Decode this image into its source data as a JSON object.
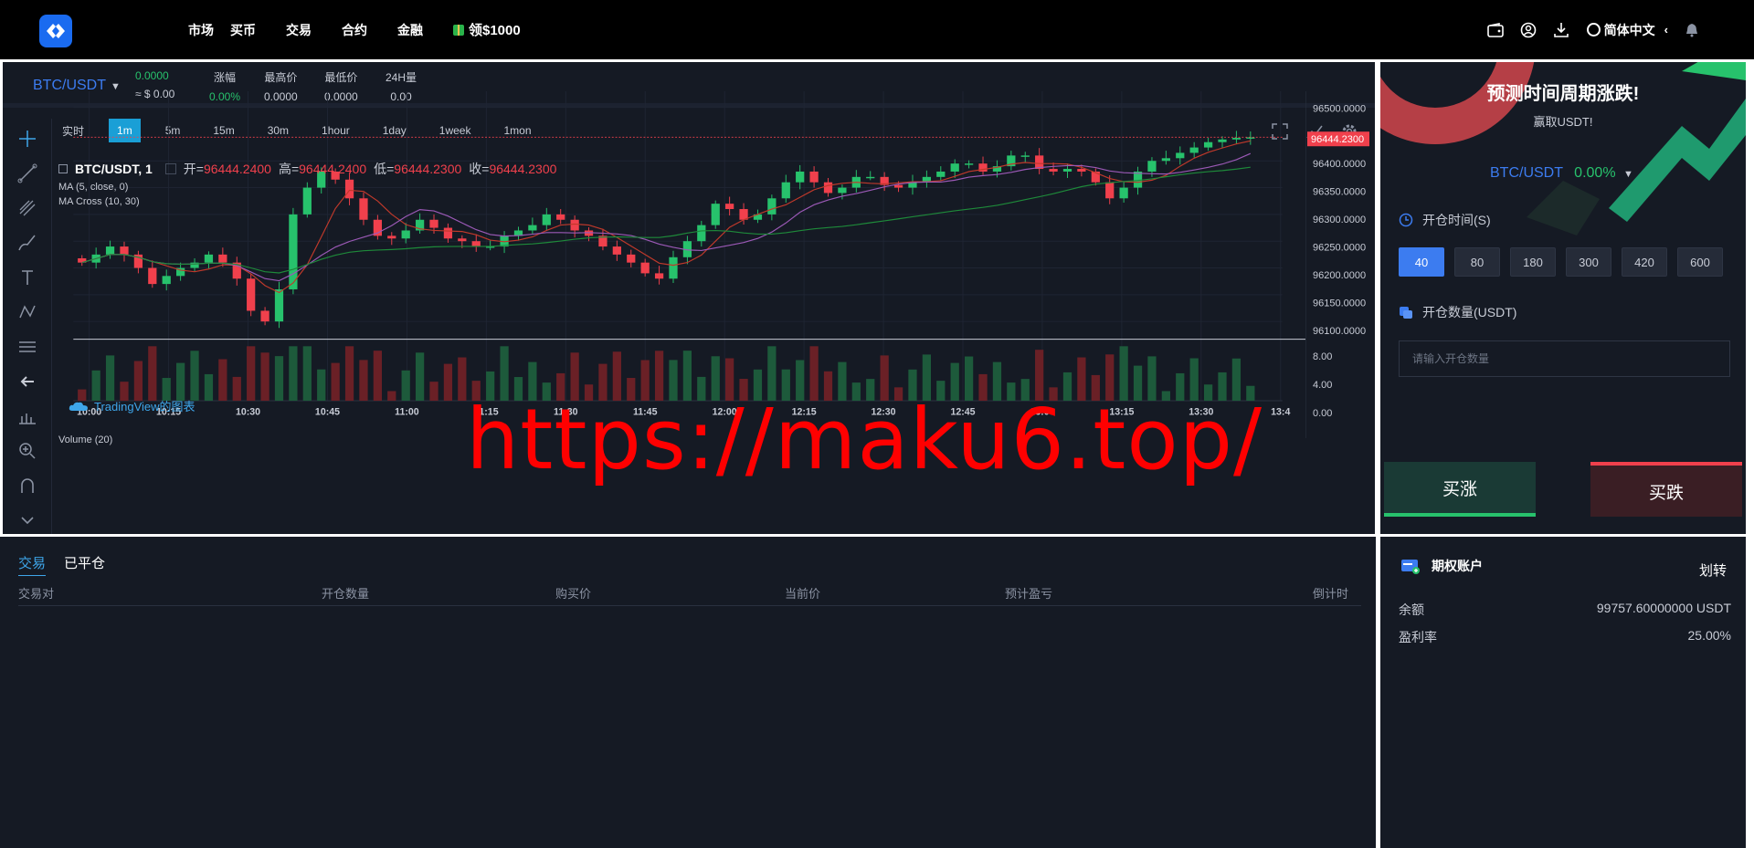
{
  "header": {
    "nav": [
      "市场",
      "买币",
      "交易",
      "合约",
      "金融"
    ],
    "promo": "领$1000",
    "language": "简体中文",
    "icons": [
      "wallet-icon",
      "user-icon",
      "download-icon",
      "globe-icon",
      "bell-icon"
    ]
  },
  "ticker": {
    "pair": "BTC/USDT",
    "price": "0.0000",
    "price_usd": "≈ $ 0.00",
    "stats": [
      {
        "label": "涨幅",
        "value": "0.00%"
      },
      {
        "label": "最高价",
        "value": "0.0000"
      },
      {
        "label": "最低价",
        "value": "0.0000"
      },
      {
        "label": "24H量",
        "value": "0.00"
      }
    ]
  },
  "chart_toolbar": {
    "timeframes": [
      "实时",
      "1m",
      "5m",
      "15m",
      "30m",
      "1hour",
      "1day",
      "1week",
      "1mon"
    ],
    "active": "1m"
  },
  "chart_data": {
    "type": "candlestick",
    "legend": {
      "symbol": "BTC/USDT, 1",
      "open_label": "开=",
      "open": "96444.2400",
      "high_label": "高=",
      "high": "96444.2400",
      "low_label": "低=",
      "low": "96444.2300",
      "close_label": "收=",
      "close": "96444.2300",
      "indicators": [
        "MA (5, close, 0)",
        "MA Cross (10, 30)"
      ],
      "volume_label": "Volume (20)"
    },
    "y_ticks": [
      "96500.0000",
      "96400.0000",
      "96350.0000",
      "96300.0000",
      "96250.0000",
      "96200.0000",
      "96150.0000",
      "96100.0000"
    ],
    "y_tick_values": [
      96500,
      96400,
      96350,
      96300,
      96250,
      96200,
      96150,
      96100
    ],
    "current_price": "96444.2300",
    "volume_ticks": [
      "8.00",
      "4.00",
      "0.00"
    ],
    "x_ticks": [
      "10:00",
      "10:15",
      "10:30",
      "10:45",
      "11:00",
      "11:15",
      "11:30",
      "11:45",
      "12:00",
      "12:15",
      "12:30",
      "12:45",
      "13:00",
      "13:15",
      "13:30",
      "13:4"
    ],
    "ylim": [
      96080,
      96530
    ],
    "closes": [
      96210,
      96225,
      96240,
      96225,
      96200,
      96170,
      96185,
      96200,
      96210,
      96225,
      96210,
      96180,
      96120,
      96100,
      96160,
      96300,
      96350,
      96380,
      96365,
      96330,
      96290,
      96260,
      96255,
      96270,
      96290,
      96275,
      96255,
      96250,
      96240,
      96240,
      96260,
      96270,
      96280,
      96300,
      96290,
      96270,
      96260,
      96240,
      96225,
      96210,
      96190,
      96180,
      96220,
      96250,
      96280,
      96320,
      96310,
      96290,
      96300,
      96330,
      96360,
      96380,
      96360,
      96340,
      96350,
      96370,
      96370,
      96355,
      96350,
      96360,
      96370,
      96380,
      96395,
      96395,
      96380,
      96390,
      96410,
      96410,
      96385,
      96380,
      96385,
      96380,
      96360,
      96330,
      96350,
      96380,
      96400,
      96405,
      96415,
      96425,
      96435,
      96440,
      96443,
      96444
    ]
  },
  "tradingview": "TradingView的图表",
  "watermark": "https://maku6.top/",
  "side": {
    "title": "预测时间周期涨跌!",
    "subtitle": "赢取USDT!",
    "pair": "BTC/USDT",
    "change": "0.00%",
    "time_label": "开仓时间(S)",
    "options": [
      "40",
      "80",
      "180",
      "300",
      "420",
      "600"
    ],
    "active_option": "40",
    "amount_label": "开仓数量(USDT)",
    "amount_placeholder": "请输入开仓数量",
    "buy_rise": "买涨",
    "buy_fall": "买跌"
  },
  "orders": {
    "tabs": [
      "交易",
      "已平仓"
    ],
    "columns": [
      "交易对",
      "开仓数量",
      "购买价",
      "当前价",
      "预计盈亏",
      "倒计时"
    ]
  },
  "account": {
    "title": "期权账户",
    "transfer": "划转",
    "rows": [
      {
        "label": "余额",
        "value": "99757.60000000 USDT"
      },
      {
        "label": "盈利率",
        "value": "25.00%"
      }
    ]
  },
  "colors": {
    "up": "#27c26c",
    "down": "#f0404c",
    "accent": "#3c7cf0",
    "bg": "#151a24"
  }
}
